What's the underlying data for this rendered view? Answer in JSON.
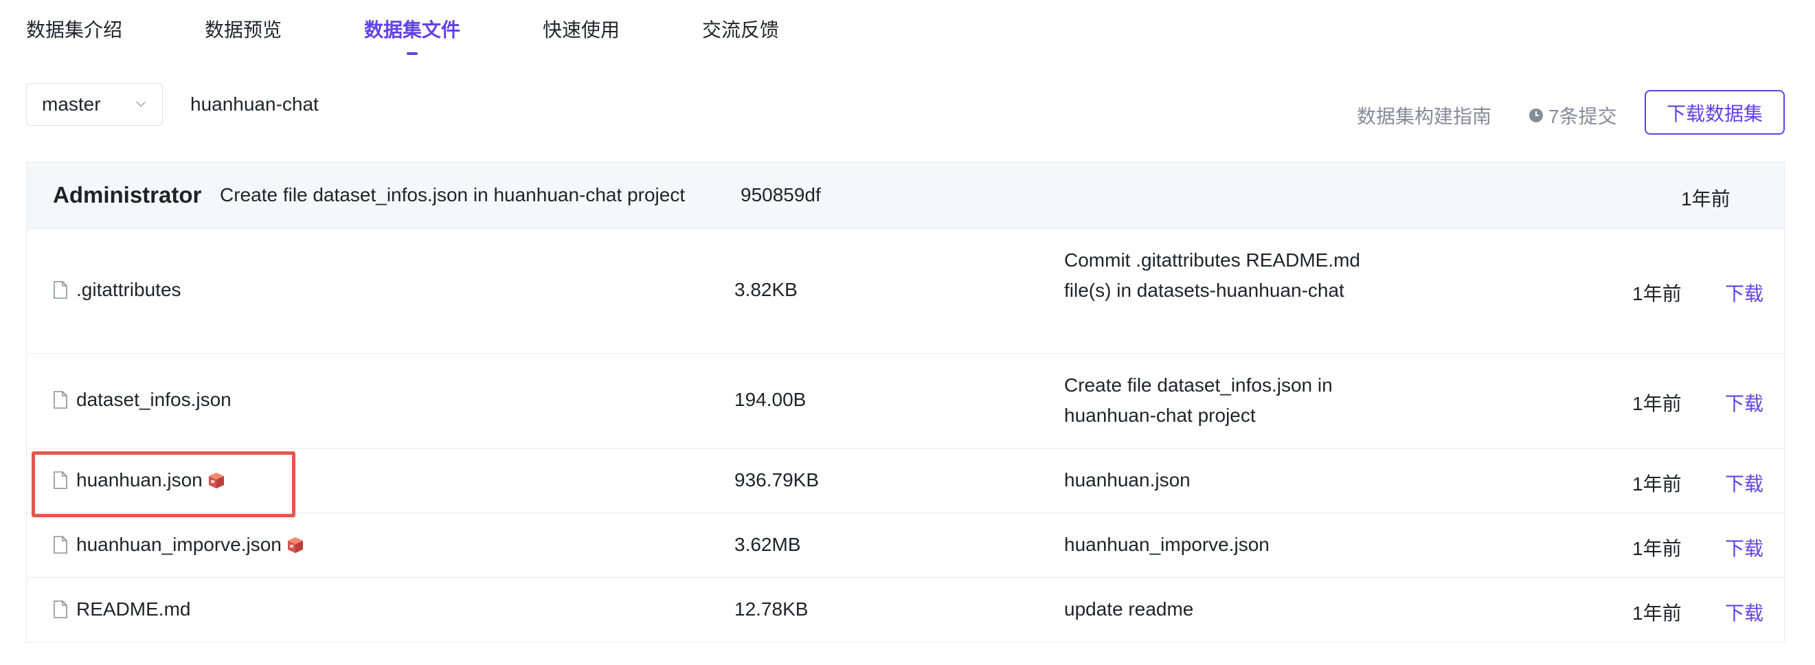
{
  "tabs": [
    {
      "label": "数据集介绍"
    },
    {
      "label": "数据预览"
    },
    {
      "label": "数据集文件"
    },
    {
      "label": "快速使用"
    },
    {
      "label": "交流反馈"
    }
  ],
  "active_tab": "数据集文件",
  "toolbar": {
    "branch": "master",
    "repo_name": "huanhuan-chat",
    "guide_label": "数据集构建指南",
    "commits_label": "7条提交",
    "download_label": "下载数据集"
  },
  "latest_commit": {
    "author": "Administrator",
    "message": "Create file dataset_infos.json in huanhuan-chat project",
    "hash": "950859df",
    "time": "1年前"
  },
  "files": [
    {
      "name": ".gitattributes",
      "lfs": false,
      "size": "3.82KB",
      "message": "Commit .gitattributes README.md file(s) in datasets-huanhuan-chat",
      "time": "1年前",
      "action": "下载"
    },
    {
      "name": "dataset_infos.json",
      "lfs": false,
      "size": "194.00B",
      "message": "Create file dataset_infos.json in huanhuan-chat project",
      "time": "1年前",
      "action": "下载"
    },
    {
      "name": "huanhuan.json",
      "lfs": true,
      "size": "936.79KB",
      "message": "huanhuan.json",
      "time": "1年前",
      "action": "下载"
    },
    {
      "name": "huanhuan_imporve.json",
      "lfs": true,
      "size": "3.62MB",
      "message": "huanhuan_imporve.json",
      "time": "1年前",
      "action": "下载"
    },
    {
      "name": "README.md",
      "lfs": false,
      "size": "12.78KB",
      "message": "update readme",
      "time": "1年前",
      "action": "下载"
    }
  ],
  "colors": {
    "accent": "#6042e8",
    "highlight": "#e2574c",
    "muted": "#858b99"
  },
  "icons": {
    "file": "file-icon",
    "lfs": "lfs-box-icon",
    "clock": "clock-icon",
    "chevron": "chevron-down-icon"
  }
}
